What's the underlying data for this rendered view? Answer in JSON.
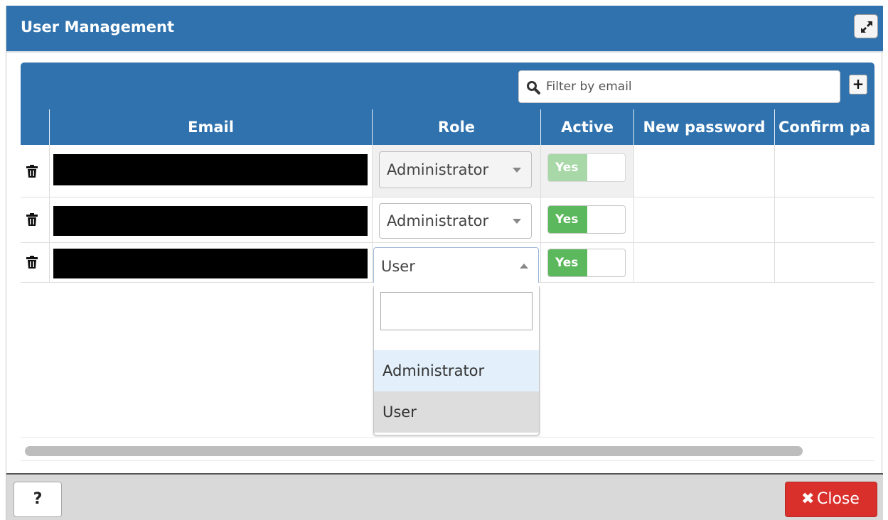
{
  "dialog": {
    "title": "User Management"
  },
  "toolbar": {
    "filter_placeholder": "Filter by email",
    "add_label": "+"
  },
  "table": {
    "columns": [
      "Email",
      "Role",
      "Active",
      "New password",
      "Confirm pa"
    ],
    "rows": [
      {
        "email": "",
        "role": "Administrator",
        "active": "Yes",
        "row_disabled": true
      },
      {
        "email": "",
        "role": "Administrator",
        "active": "Yes",
        "row_disabled": false
      },
      {
        "email": "",
        "role": "User",
        "active": "Yes",
        "row_disabled": false,
        "role_dropdown_open": true
      }
    ]
  },
  "role_dropdown": {
    "search_value": "",
    "options": [
      "Administrator",
      "User"
    ],
    "highlighted": "Administrator",
    "selected": "User"
  },
  "footer": {
    "help_label": "?",
    "close_label": "Close"
  },
  "colors": {
    "header_blue": "#2f72ae",
    "toggle_green": "#5cb85c",
    "close_red": "#d9302c"
  },
  "icons": [
    "maximize-icon",
    "search-icon",
    "trash-icon",
    "close-x-icon"
  ]
}
